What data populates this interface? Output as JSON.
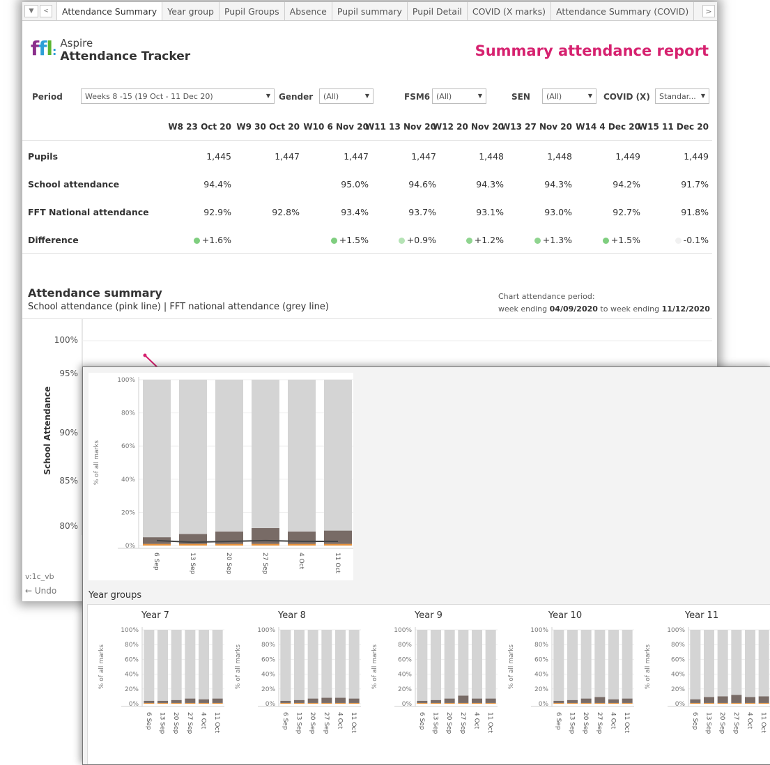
{
  "tabs": {
    "items": [
      "Attendance Summary",
      "Year group",
      "Pupil Groups",
      "Absence",
      "Pupil summary",
      "Pupil Detail",
      "COVID (X marks)",
      "Attendance Summary (COVID)"
    ]
  },
  "app": {
    "logo_mark": "ffl:",
    "name_line1": "Aspire",
    "name_line2": "Attendance Tracker",
    "report_title": "Summary attendance report"
  },
  "filters": {
    "period_label": "Period",
    "period_value": "Weeks 8 -15 (19 Oct - 11 Dec 20)",
    "gender_label": "Gender",
    "gender_value": "(All)",
    "fsm6_label": "FSM6",
    "fsm6_value": "(All)",
    "sen_label": "SEN",
    "sen_value": "(All)",
    "covid_label": "COVID (X)",
    "covid_value": "Standar..."
  },
  "summary_table": {
    "columns": [
      "W8 23 Oct 20",
      "W9 30 Oct 20",
      "W10 6 Nov 20",
      "W11 13 Nov 20",
      "W12 20 Nov 20",
      "W13 27 Nov 20",
      "W14 4 Dec 20",
      "W15 11 Dec 20"
    ],
    "rows": [
      {
        "label": "Pupils",
        "values": [
          "1,445",
          "1,447",
          "1,447",
          "1,447",
          "1,448",
          "1,448",
          "1,449",
          "1,449"
        ]
      },
      {
        "label": "School attendance",
        "values": [
          "94.4%",
          "",
          "95.0%",
          "94.6%",
          "94.3%",
          "94.3%",
          "94.2%",
          "91.7%"
        ]
      },
      {
        "label": "FFT National attendance",
        "values": [
          "92.9%",
          "92.8%",
          "93.4%",
          "93.7%",
          "93.1%",
          "93.0%",
          "92.7%",
          "91.8%"
        ]
      },
      {
        "label": "Difference",
        "values": [
          "+1.6%",
          "",
          "+1.5%",
          "+0.9%",
          "+1.2%",
          "+1.3%",
          "+1.5%",
          "-0.1%"
        ],
        "dot_colors": [
          "#7fce7f",
          "",
          "#7fce7f",
          "#b5e3b5",
          "#8fd48f",
          "#8fd48f",
          "#7fce7f",
          "#f1f1f1"
        ]
      }
    ]
  },
  "attendance_summary": {
    "title": "Attendance summary",
    "subtitle": "School attendance (pink line)  |  FFT national attendance (grey line)",
    "period_label": "Chart attendance period:",
    "period_prefix": "week ending ",
    "period_start": "04/09/2020",
    "period_mid": " to week ending ",
    "period_end": "11/12/2020",
    "y_axis_title": "School Attendance",
    "y_ticks": [
      "100%",
      "95%",
      "90%",
      "85%",
      "80%"
    ]
  },
  "footer": {
    "version": "v:1c_vb",
    "undo": "Undo"
  },
  "colors": {
    "pink": "#d6216f",
    "present": "#d4d4d4",
    "absent": "#786b66",
    "covid": "#e8923a",
    "line": "#444444"
  },
  "chart_data": [
    {
      "type": "bar",
      "stacked": true,
      "ylabel": "% of all marks",
      "categories": [
        "6 Sep",
        "13 Sep",
        "20 Sep",
        "27 Sep",
        "4 Oct",
        "11 Oct"
      ],
      "y_ticks": [
        "100%",
        "80%",
        "60%",
        "40%",
        "20%",
        "0%"
      ],
      "ylim": [
        0,
        100
      ],
      "series": [
        {
          "values": [
            1,
            1,
            1,
            1,
            1,
            1
          ],
          "color": "#e8923a"
        },
        {
          "values": [
            4,
            6,
            7.5,
            9.5,
            7.5,
            8
          ],
          "color": "#786b66"
        },
        {
          "values": [
            95,
            93,
            91.5,
            89.5,
            91.5,
            91
          ],
          "color": "#d4d4d4"
        }
      ],
      "line_values": [
        3,
        2,
        2.5,
        3,
        2.5,
        2.5
      ]
    },
    {
      "type": "bar",
      "stacked": true,
      "title": "Year 7",
      "ylabel": "% of all marks",
      "categories": [
        "6 Sep",
        "13 Sep",
        "20 Sep",
        "27 Sep",
        "4 Oct",
        "11 Oct"
      ],
      "y_ticks": [
        "100%",
        "80%",
        "60%",
        "40%",
        "20%",
        "0%"
      ],
      "ylim": [
        0,
        100
      ],
      "series": [
        {
          "values": [
            1,
            1,
            1,
            1,
            1,
            1
          ]
        },
        {
          "values": [
            3,
            3,
            4,
            6,
            5,
            6
          ]
        },
        {
          "values": [
            96,
            96,
            95,
            93,
            94,
            93
          ]
        }
      ]
    },
    {
      "type": "bar",
      "stacked": true,
      "title": "Year 8",
      "ylabel": "% of all marks",
      "categories": [
        "6 Sep",
        "13 Sep",
        "20 Sep",
        "27 Sep",
        "4 Oct",
        "11 Oct"
      ],
      "y_ticks": [
        "100%",
        "80%",
        "60%",
        "40%",
        "20%",
        "0%"
      ],
      "ylim": [
        0,
        100
      ],
      "series": [
        {
          "values": [
            1,
            1,
            1,
            1,
            1,
            1
          ]
        },
        {
          "values": [
            3,
            4,
            6,
            7,
            7,
            6
          ]
        },
        {
          "values": [
            96,
            95,
            93,
            92,
            92,
            93
          ]
        }
      ]
    },
    {
      "type": "bar",
      "stacked": true,
      "title": "Year 9",
      "ylabel": "% of all marks",
      "categories": [
        "6 Sep",
        "13 Sep",
        "20 Sep",
        "27 Sep",
        "4 Oct",
        "11 Oct"
      ],
      "y_ticks": [
        "100%",
        "80%",
        "60%",
        "40%",
        "20%",
        "0%"
      ],
      "ylim": [
        0,
        100
      ],
      "series": [
        {
          "values": [
            1,
            1,
            1,
            1,
            1,
            1
          ]
        },
        {
          "values": [
            3,
            4,
            6,
            10,
            6,
            6
          ]
        },
        {
          "values": [
            96,
            95,
            93,
            89,
            93,
            93
          ]
        }
      ]
    },
    {
      "type": "bar",
      "stacked": true,
      "title": "Year 10",
      "ylabel": "% of all marks",
      "categories": [
        "6 Sep",
        "13 Sep",
        "20 Sep",
        "27 Sep",
        "4 Oct",
        "11 Oct"
      ],
      "y_ticks": [
        "100%",
        "80%",
        "60%",
        "40%",
        "20%",
        "0%"
      ],
      "ylim": [
        0,
        100
      ],
      "series": [
        {
          "values": [
            1,
            1,
            1,
            1,
            1,
            1
          ]
        },
        {
          "values": [
            3,
            4,
            6,
            8,
            5,
            6
          ]
        },
        {
          "values": [
            96,
            95,
            93,
            91,
            94,
            93
          ]
        }
      ]
    },
    {
      "type": "bar",
      "stacked": true,
      "title": "Year 11",
      "ylabel": "% of all marks",
      "categories": [
        "6 Sep",
        "13 Sep",
        "20 Sep",
        "27 Sep",
        "4 Oct",
        "11 Oct"
      ],
      "y_ticks": [
        "100%",
        "80%",
        "60%",
        "40%",
        "20%",
        "0%"
      ],
      "ylim": [
        0,
        100
      ],
      "series": [
        {
          "values": [
            1,
            1,
            1,
            1,
            1,
            1
          ]
        },
        {
          "values": [
            5,
            8,
            9,
            11,
            8,
            9
          ]
        },
        {
          "values": [
            94,
            91,
            90,
            88,
            91,
            90
          ]
        }
      ]
    }
  ],
  "year_groups_title": "Year groups"
}
